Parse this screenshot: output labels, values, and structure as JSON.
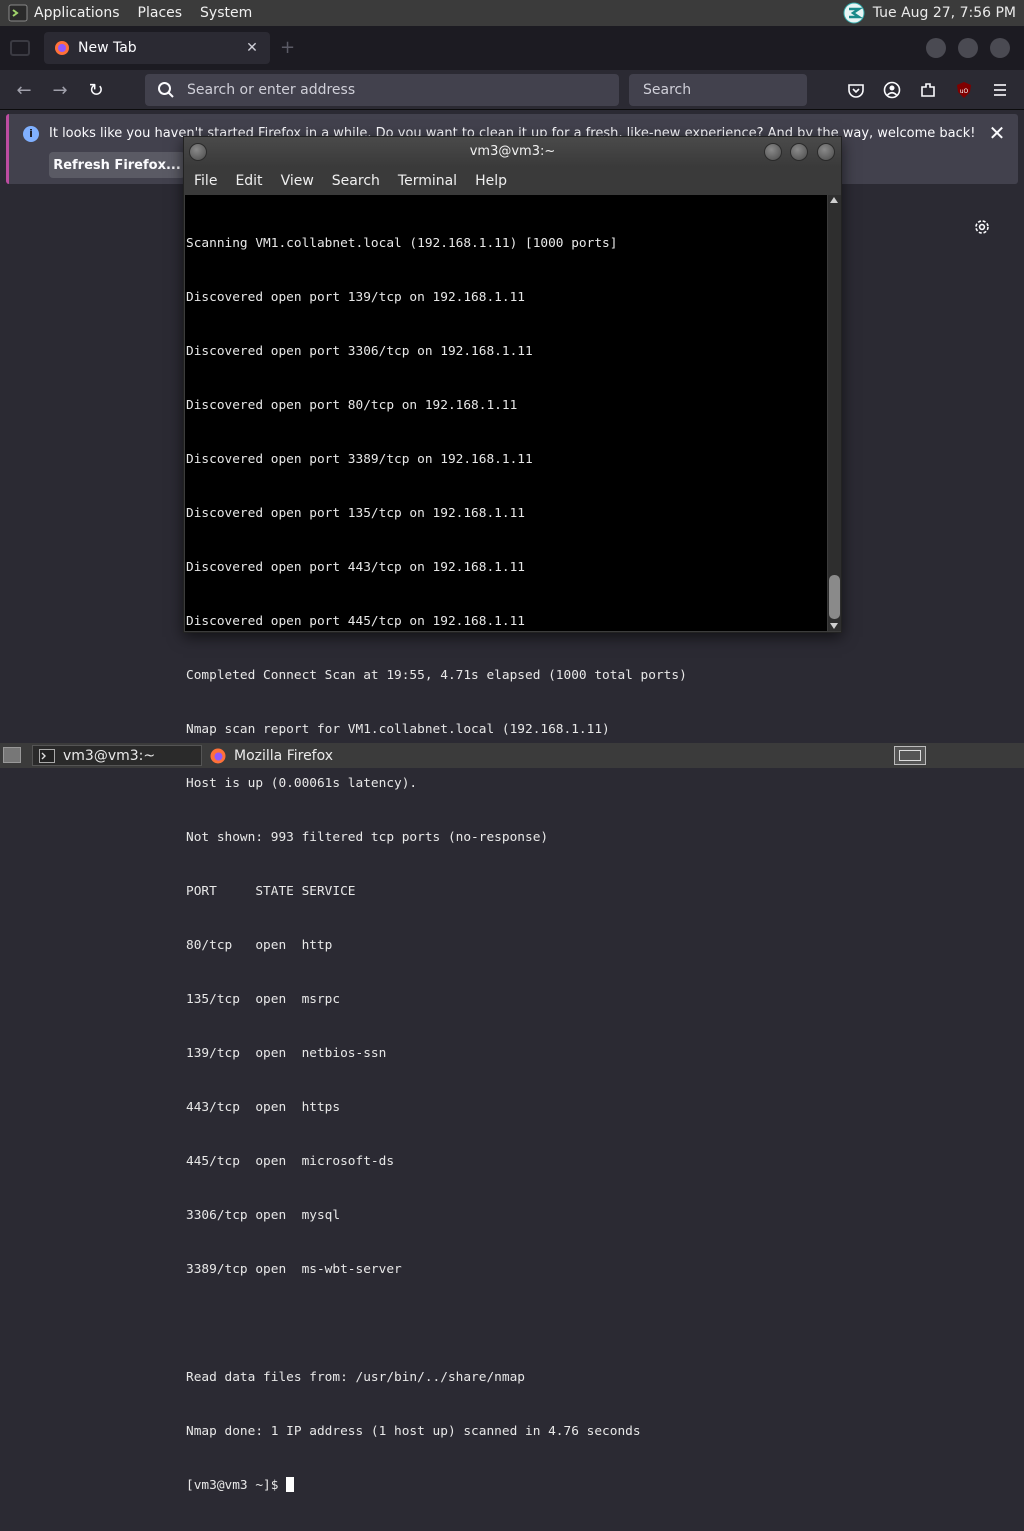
{
  "top_panel": {
    "menu": [
      "Applications",
      "Places",
      "System"
    ],
    "clock": "Tue Aug 27,  7:56 PM"
  },
  "firefox": {
    "tab_title": "New Tab",
    "url_placeholder": "Search or enter address",
    "search_placeholder": "Search",
    "notification": {
      "message": "It looks like you haven't started Firefox in a while. Do you want to clean it up for a fresh, like-new experience? And by the way, welcome back!",
      "button": "Refresh Firefox..."
    }
  },
  "terminal": {
    "title": "vm3@vm3:~",
    "menu": [
      "File",
      "Edit",
      "View",
      "Search",
      "Terminal",
      "Help"
    ],
    "lines": [
      "Scanning VM1.collabnet.local (192.168.1.11) [1000 ports]",
      "Discovered open port 139/tcp on 192.168.1.11",
      "Discovered open port 3306/tcp on 192.168.1.11",
      "Discovered open port 80/tcp on 192.168.1.11",
      "Discovered open port 3389/tcp on 192.168.1.11",
      "Discovered open port 135/tcp on 192.168.1.11",
      "Discovered open port 443/tcp on 192.168.1.11",
      "Discovered open port 445/tcp on 192.168.1.11",
      "Completed Connect Scan at 19:55, 4.71s elapsed (1000 total ports)",
      "Nmap scan report for VM1.collabnet.local (192.168.1.11)",
      "Host is up (0.00061s latency).",
      "Not shown: 993 filtered tcp ports (no-response)",
      "PORT     STATE SERVICE",
      "80/tcp   open  http",
      "135/tcp  open  msrpc",
      "139/tcp  open  netbios-ssn",
      "443/tcp  open  https",
      "445/tcp  open  microsoft-ds",
      "3306/tcp open  mysql",
      "3389/tcp open  ms-wbt-server",
      "",
      "Read data files from: /usr/bin/../share/nmap",
      "Nmap done: 1 IP address (1 host up) scanned in 4.76 seconds"
    ],
    "prompt": "[vm3@vm3 ~]$ "
  },
  "taskbar": {
    "tasks": [
      "vm3@vm3:~",
      "Mozilla Firefox"
    ]
  }
}
